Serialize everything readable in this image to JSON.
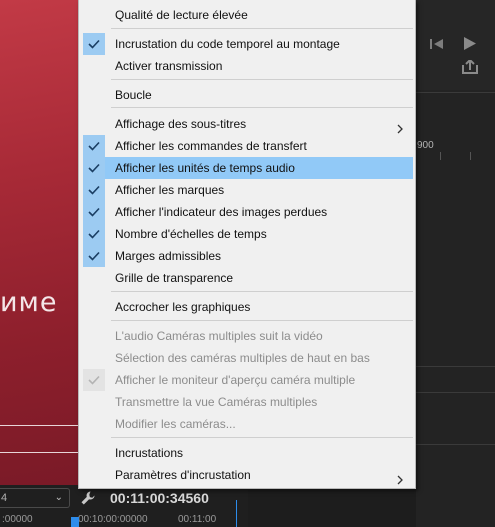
{
  "preview": {
    "text": "име"
  },
  "right_panel": {
    "ruler_label": "900"
  },
  "bottom_bar": {
    "zoom_value": "4",
    "timecode": "00:11:00:34560",
    "ruler_labels": [
      ":00000",
      "00:10:00:00000",
      "00:11:00"
    ]
  },
  "menu": {
    "items": [
      {
        "label": "Qualité de lecture élevée",
        "checked": false,
        "disabled": false
      },
      {
        "label": "Incrustation du code temporel au montage",
        "checked": true,
        "disabled": false
      },
      {
        "label": "Activer transmission",
        "checked": false,
        "disabled": false
      },
      {
        "label": "Boucle",
        "checked": false,
        "disabled": false
      },
      {
        "label": "Affichage des sous-titres",
        "checked": false,
        "disabled": false,
        "submenu": true
      },
      {
        "label": "Afficher les commandes de transfert",
        "checked": true,
        "disabled": false
      },
      {
        "label": "Afficher les unités de temps audio",
        "checked": true,
        "disabled": false,
        "highlighted": true
      },
      {
        "label": "Afficher les marques",
        "checked": true,
        "disabled": false
      },
      {
        "label": "Afficher l'indicateur des images perdues",
        "checked": true,
        "disabled": false
      },
      {
        "label": "Nombre d'échelles de temps",
        "checked": true,
        "disabled": false
      },
      {
        "label": "Marges admissibles",
        "checked": true,
        "disabled": false
      },
      {
        "label": "Grille de transparence",
        "checked": false,
        "disabled": false
      },
      {
        "label": "Accrocher les graphiques",
        "checked": false,
        "disabled": false
      },
      {
        "label": "L'audio Caméras multiples suit la vidéo",
        "checked": false,
        "disabled": true
      },
      {
        "label": "Sélection des caméras multiples de haut en bas",
        "checked": false,
        "disabled": true
      },
      {
        "label": "Afficher le moniteur d'aperçu caméra multiple",
        "checked": true,
        "disabled": true
      },
      {
        "label": "Transmettre la vue Caméras multiples",
        "checked": false,
        "disabled": true
      },
      {
        "label": "Modifier les caméras...",
        "checked": false,
        "disabled": true
      },
      {
        "label": "Incrustations",
        "checked": false,
        "disabled": false
      },
      {
        "label": "Paramètres d'incrustation",
        "checked": false,
        "disabled": false,
        "submenu": true
      }
    ]
  },
  "colors": {
    "highlight": "#91c9f7",
    "check_bg": "#9ccbf2",
    "accent_blue": "#2d8ceb"
  }
}
